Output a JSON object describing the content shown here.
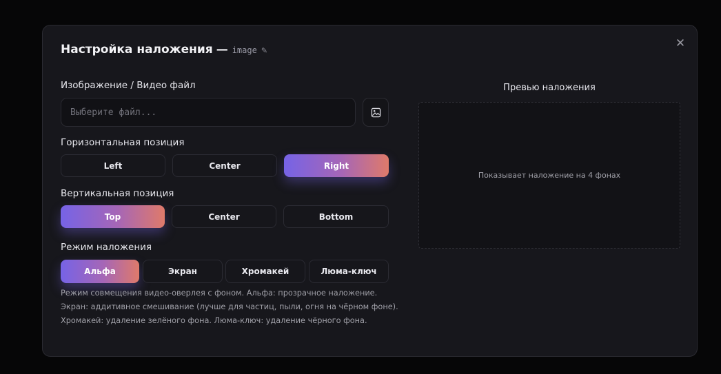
{
  "dialog": {
    "title": "Настройка наложения",
    "title_separator": "—",
    "overlay_name": "image",
    "close_icon": "close-icon"
  },
  "file": {
    "label": "Изображение / Видео файл",
    "placeholder": "Выберите файл...",
    "browse_icon": "image-icon"
  },
  "horizontal": {
    "label": "Горизонтальная позиция",
    "options": [
      "Left",
      "Center",
      "Right"
    ],
    "selected": "Right"
  },
  "vertical": {
    "label": "Вертикальная позиция",
    "options": [
      "Top",
      "Center",
      "Bottom"
    ],
    "selected": "Top"
  },
  "blend": {
    "label": "Режим наложения",
    "options": [
      "Альфа",
      "Экран",
      "Хромакей",
      "Люма-ключ"
    ],
    "selected": "Альфа",
    "help": [
      "Режим совмещения видео-оверлея с фоном. Альфа: прозрачное наложение.",
      "Экран: аддитивное смешивание (лучше для частиц, пыли, огня на чёрном фоне).",
      "Хромакей: удаление зелёного фона. Люма-ключ: удаление чёрного фона."
    ]
  },
  "preview": {
    "title": "Превью наложения",
    "hint": "Показывает наложение на 4 фонах"
  },
  "colors": {
    "accent_start": "#7663e6",
    "accent_end": "#df7a6a",
    "modal_bg": "#17171c"
  }
}
